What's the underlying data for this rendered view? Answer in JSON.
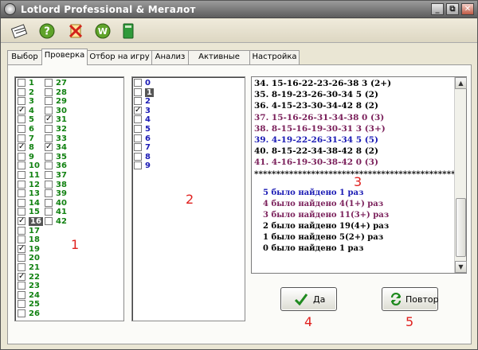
{
  "window": {
    "title": "Lotlord Professional & Мегалот",
    "buttons": [
      "_",
      "⧉",
      "✕"
    ]
  },
  "toolbar": {
    "icons": [
      "lotto-icon",
      "help-icon",
      "close-cross-icon",
      "w-icon",
      "book-icon"
    ]
  },
  "tabs": [
    {
      "label": "Выбор",
      "active": false
    },
    {
      "label": "Проверка",
      "active": true
    },
    {
      "label": "Отбор на игру",
      "active": false
    },
    {
      "label": "Анализ",
      "active": false
    },
    {
      "label": "Активные зоны",
      "active": false
    },
    {
      "label": "Настройка",
      "active": false
    }
  ],
  "numbers_col1": [
    {
      "n": "1",
      "checked": false
    },
    {
      "n": "2",
      "checked": false
    },
    {
      "n": "3",
      "checked": false
    },
    {
      "n": "4",
      "checked": true
    },
    {
      "n": "5",
      "checked": false
    },
    {
      "n": "6",
      "checked": false
    },
    {
      "n": "7",
      "checked": false
    },
    {
      "n": "8",
      "checked": true
    },
    {
      "n": "9",
      "checked": false
    },
    {
      "n": "10",
      "checked": false
    },
    {
      "n": "11",
      "checked": false
    },
    {
      "n": "12",
      "checked": false
    },
    {
      "n": "13",
      "checked": false
    },
    {
      "n": "14",
      "checked": false
    },
    {
      "n": "15",
      "checked": false
    },
    {
      "n": "16",
      "checked": true,
      "selected": true
    },
    {
      "n": "17",
      "checked": false
    },
    {
      "n": "18",
      "checked": false
    },
    {
      "n": "19",
      "checked": true
    },
    {
      "n": "20",
      "checked": false
    },
    {
      "n": "21",
      "checked": false
    },
    {
      "n": "22",
      "checked": true
    },
    {
      "n": "23",
      "checked": false
    },
    {
      "n": "24",
      "checked": false
    },
    {
      "n": "25",
      "checked": false
    },
    {
      "n": "26",
      "checked": false
    }
  ],
  "numbers_col2": [
    {
      "n": "27",
      "checked": false
    },
    {
      "n": "28",
      "checked": false
    },
    {
      "n": "29",
      "checked": false
    },
    {
      "n": "30",
      "checked": false
    },
    {
      "n": "31",
      "checked": true
    },
    {
      "n": "32",
      "checked": false
    },
    {
      "n": "33",
      "checked": false
    },
    {
      "n": "34",
      "checked": true
    },
    {
      "n": "35",
      "checked": false
    },
    {
      "n": "36",
      "checked": false
    },
    {
      "n": "37",
      "checked": false
    },
    {
      "n": "38",
      "checked": false
    },
    {
      "n": "39",
      "checked": false
    },
    {
      "n": "40",
      "checked": false
    },
    {
      "n": "41",
      "checked": false
    },
    {
      "n": "42",
      "checked": false
    }
  ],
  "bonus_numbers": [
    {
      "n": "0",
      "checked": false
    },
    {
      "n": "1",
      "checked": false,
      "selected": true
    },
    {
      "n": "2",
      "checked": false
    },
    {
      "n": "3",
      "checked": true
    },
    {
      "n": "4",
      "checked": false
    },
    {
      "n": "5",
      "checked": false
    },
    {
      "n": "6",
      "checked": false
    },
    {
      "n": "7",
      "checked": false
    },
    {
      "n": "8",
      "checked": false
    },
    {
      "n": "9",
      "checked": false
    }
  ],
  "results": [
    {
      "text": "34. 15-16-22-23-26-38  3  (2+)",
      "color": "#000000"
    },
    {
      "text": "35. 8-19-23-26-30-34  5  (2)",
      "color": "#000000"
    },
    {
      "text": "36. 4-15-23-30-34-42  8  (2)",
      "color": "#000000"
    },
    {
      "text": "37. 15-16-26-31-34-38  0  (3)",
      "color": "#7a1f5a"
    },
    {
      "text": "38. 8-15-16-19-30-31  3  (3+)",
      "color": "#7a1f5a"
    },
    {
      "text": "39. 4-19-22-26-31-34  5  (5)",
      "color": "#1a1ab4"
    },
    {
      "text": "40. 8-15-22-34-38-42  8  (2)",
      "color": "#000000"
    },
    {
      "text": "41. 4-16-19-30-38-42  0  (3)",
      "color": "#7a1f5a"
    },
    {
      "text": "**********************************************",
      "color": "#000000"
    }
  ],
  "summary": [
    {
      "text": "5 было найдено 1 раз",
      "color": "#1a1ab4"
    },
    {
      "text": "4 было найдено 4(1+) раз",
      "color": "#7a1f5a"
    },
    {
      "text": "3 было найдено 11(3+) раз",
      "color": "#7a1f5a"
    },
    {
      "text": "2 было найдено 19(4+) раз",
      "color": "#000000"
    },
    {
      "text": "1 было найдено 5(2+) раз",
      "color": "#000000"
    },
    {
      "text": "0 было найдено 1 раз",
      "color": "#000000"
    }
  ],
  "buttons": {
    "yes_label": "Да",
    "repeat_label": "Повтор"
  },
  "annotations": {
    "n1": "1",
    "n2": "2",
    "n3": "3",
    "n4": "4",
    "n5": "5"
  },
  "colors": {
    "number_green": "#128212",
    "number_blue": "#1a1ab4",
    "annotation_red": "#e0201e"
  }
}
